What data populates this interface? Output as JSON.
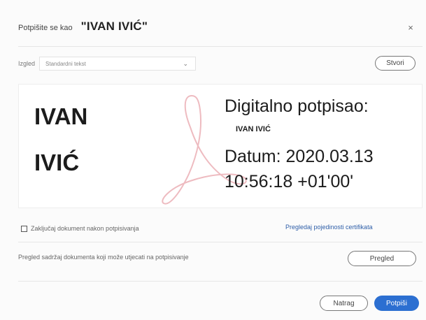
{
  "dialog": {
    "title_prefix": "Potpišite se kao",
    "title_name": "\"IVAN IVIĆ\"",
    "close_glyph": "×"
  },
  "appearance": {
    "label": "Izgled",
    "selected": "Standardni tekst",
    "chevron_glyph": "⌄",
    "create_label": "Stvori"
  },
  "signature_preview": {
    "name_line1": "IVAN",
    "name_line2": "IVIĆ",
    "info_heading": "Digitalno potpisao:",
    "info_signer": "IVAN IVIĆ",
    "info_date": "Datum: 2020.03.13",
    "info_time": "10:56:18 +01'00'",
    "watermark_icon": "adobe-acrobat-logo",
    "watermark_color": "#e8a4ab"
  },
  "options": {
    "lock_label": "Zaključaj dokument nakon potpisivanja",
    "lock_checked": false,
    "cert_link": "Pregledaj pojedinosti certifikata",
    "review_text": "Pregled sadržaj dokumenta koji može utjecati na potpisivanje",
    "review_button": "Pregled"
  },
  "footer": {
    "back_button": "Natrag",
    "sign_button": "Potpiši"
  },
  "colors": {
    "accent": "#2c6fd1",
    "link": "#2e5ea8"
  }
}
